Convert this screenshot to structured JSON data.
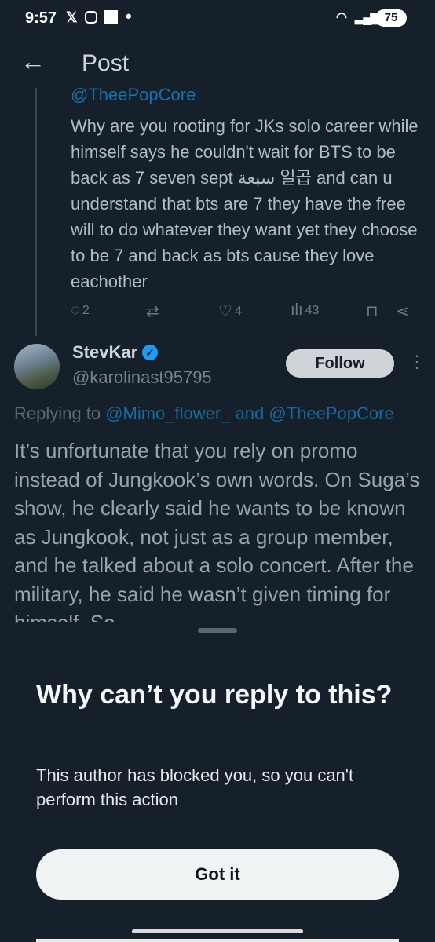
{
  "status_bar": {
    "time": "9:57",
    "battery": "75"
  },
  "header": {
    "title": "Post"
  },
  "quoted_tweet": {
    "handle": "@TheePopCore",
    "text": "Why are you rooting for JKs solo career while himself says he couldn't wait for BTS to be back as 7 seven sept سبعة 일곱 and can u understand that bts are 7 they have the free will to do whatever they want yet they choose to be 7 and back as bts cause they love eachother",
    "replies": "2",
    "likes": "4",
    "views": "43"
  },
  "reply_tweet": {
    "name": "StevKar",
    "handle": "@karolinast95795",
    "follow_label": "Follow",
    "replying_prefix": "Replying to ",
    "replying_user1": "@Mimo_flower_",
    "replying_and": " and ",
    "replying_user2": "@TheePopCore",
    "text": "It’s unfortunate that you rely on promo instead of Jungkook’s own words. On Suga’s show, he clearly said he wants to be known as Jungkook, not just as a group member, and he talked about a solo concert. After the military, he said he wasn’t given timing for himself. So"
  },
  "sheet": {
    "title": "Why can’t you reply to this?",
    "message": "This author has blocked you, so you can't perform this action",
    "button_label": "Got it"
  },
  "colors": {
    "background": "#15202b",
    "accent": "#1d9bf0",
    "button": "#eff3f4"
  },
  "icons": [
    "back-arrow-icon",
    "reply-icon",
    "retweet-icon",
    "like-icon",
    "views-icon",
    "bookmark-icon",
    "share-icon",
    "verified-icon",
    "more-icon"
  ]
}
